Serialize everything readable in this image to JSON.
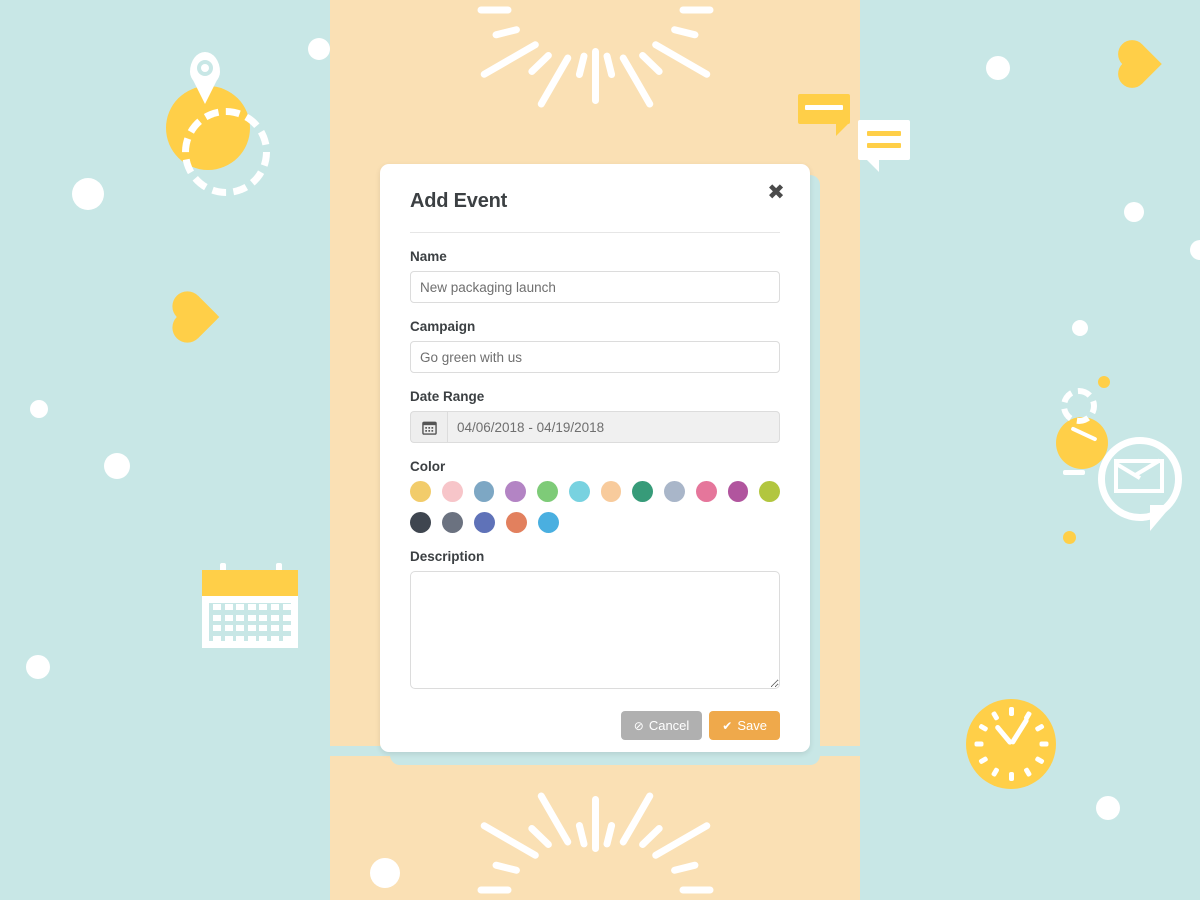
{
  "background": {
    "page_color": "#c8e7e6",
    "band_color": "#fae0b4",
    "accent_yellow": "#ffcf48",
    "decorations": [
      "map-pin-icon",
      "dashed-circle",
      "heart-icon",
      "calendar-icon",
      "speech-bubble-yellow",
      "speech-bubble-white",
      "clock-icon",
      "envelope-chat-icon",
      "sunburst-rays",
      "dots"
    ]
  },
  "modal": {
    "title": "Add Event",
    "close_label": "✖",
    "shadow_card_color": "#c8e7e6",
    "fields": {
      "name": {
        "label": "Name",
        "value": "New packaging launch",
        "placeholder": "New packaging launch"
      },
      "campaign": {
        "label": "Campaign",
        "value": "Go green with us",
        "placeholder": "Go green with us"
      },
      "date_range": {
        "label": "Date Range",
        "value": "04/06/2018 - 04/19/2018",
        "placeholder": "04/06/2018 - 04/19/2018",
        "icon": "calendar-icon"
      },
      "color": {
        "label": "Color",
        "rows": [
          [
            "#f2cc6b",
            "#f7c5c9",
            "#7da7c4",
            "#b384c4",
            "#7ecb78",
            "#78d2e0",
            "#f8cb9c",
            "#379b79",
            "#a9b6c9",
            "#e5769b",
            "#b1559e",
            "#b2c63f"
          ],
          [
            "#3f4650",
            "#6b7280",
            "#5f72b8",
            "#e2805e",
            "#4aafe0"
          ]
        ]
      },
      "description": {
        "label": "Description",
        "value": "",
        "placeholder": ""
      }
    },
    "footer": {
      "cancel_label": "Cancel",
      "cancel_icon": "ban-icon",
      "cancel_glyph": "⊘",
      "save_label": "Save",
      "save_icon": "check-icon",
      "save_glyph": "✔",
      "cancel_color": "#b0b0b0",
      "save_color": "#efa94b"
    }
  }
}
